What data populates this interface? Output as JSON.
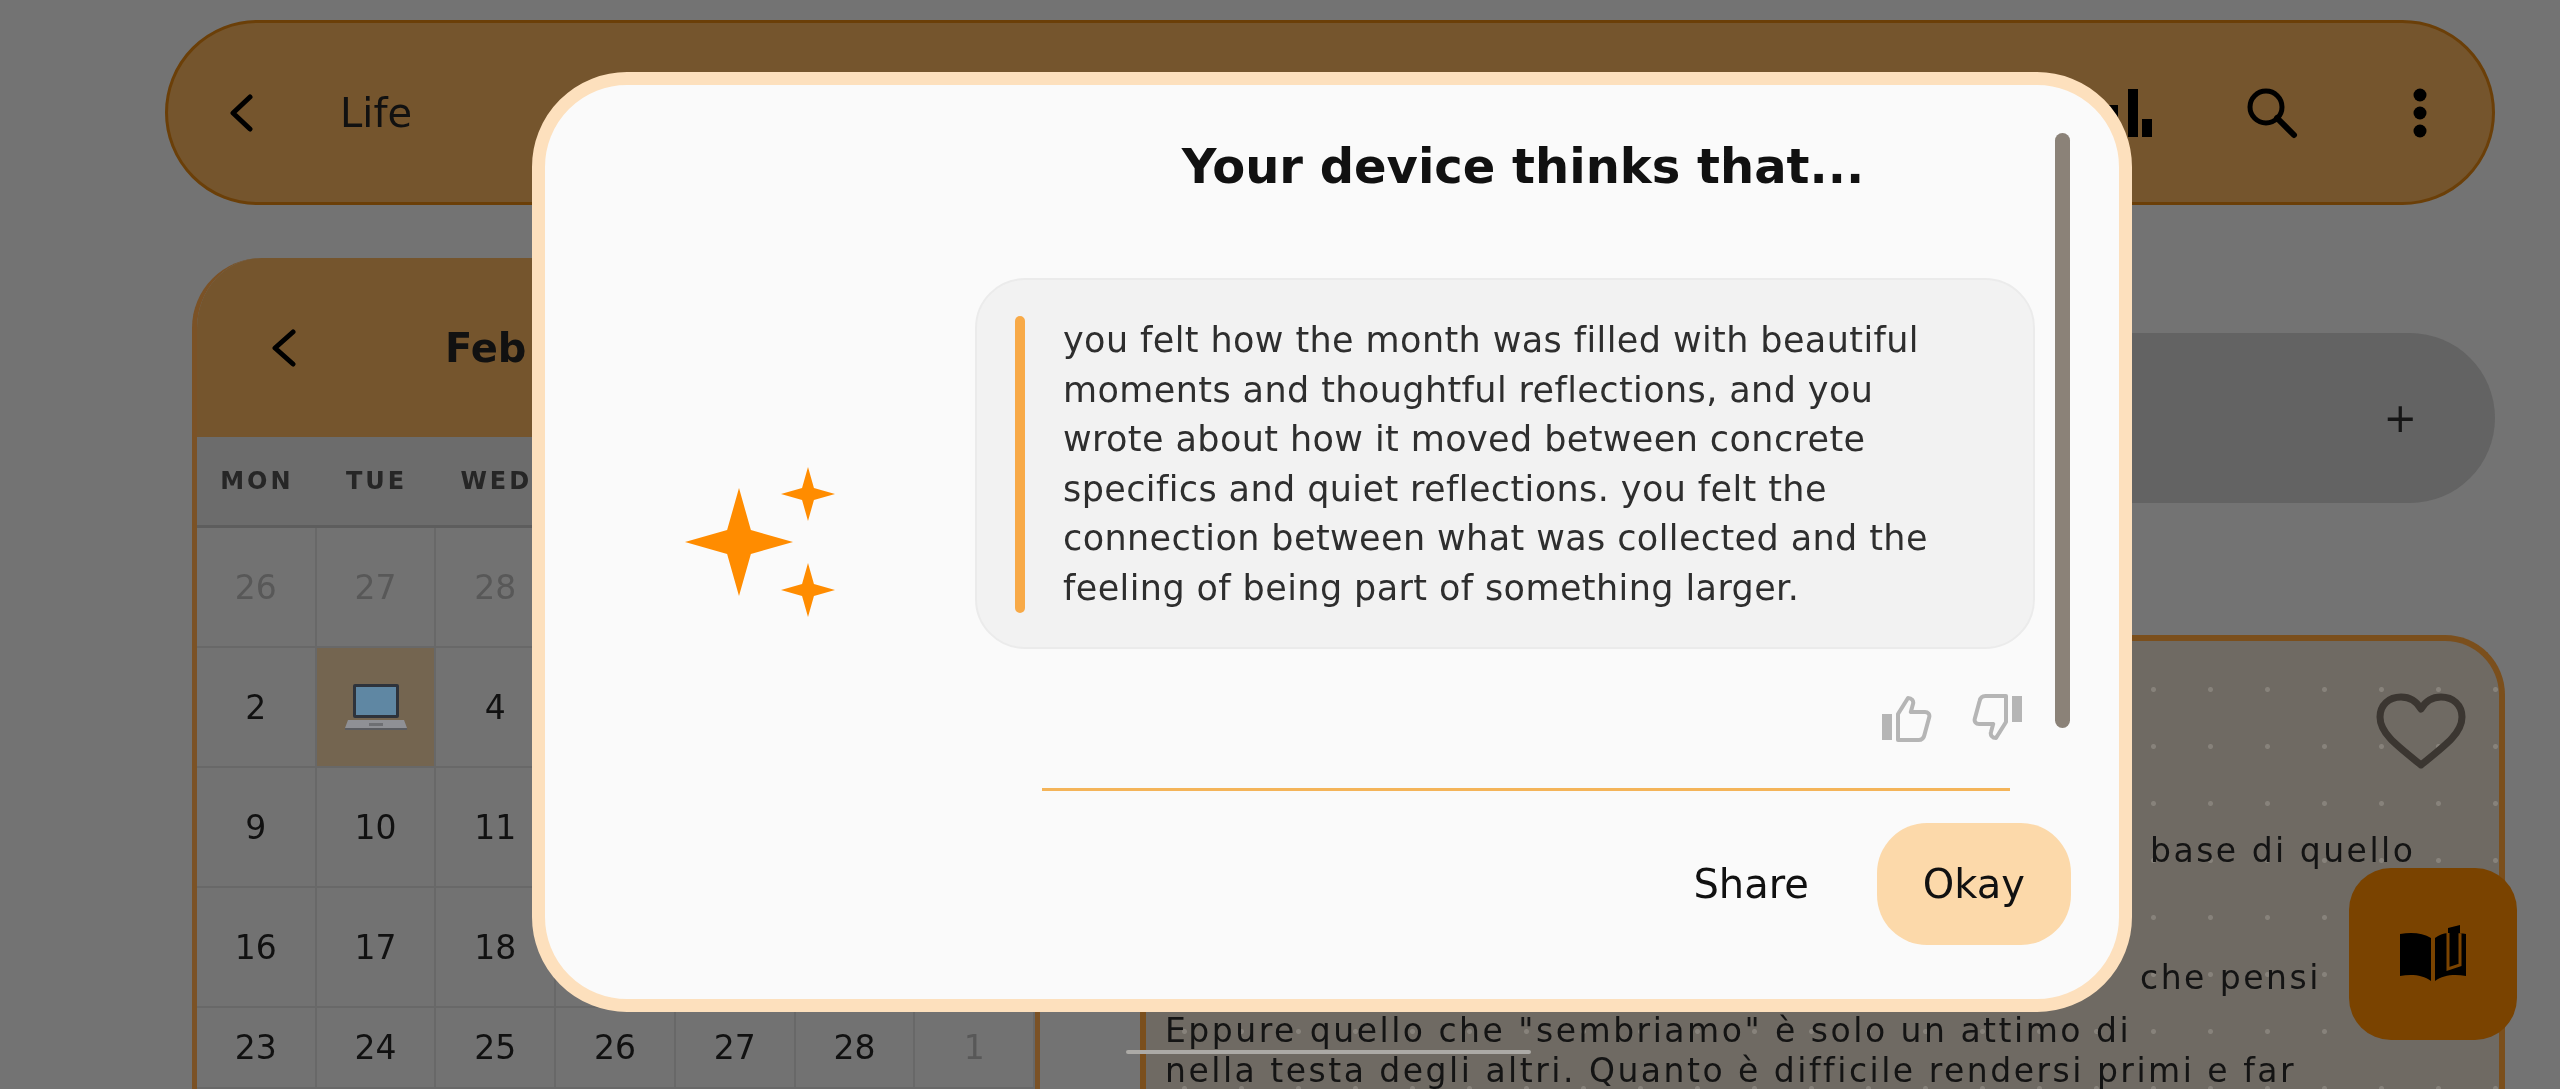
{
  "top_bar": {
    "title": "Life"
  },
  "calendar": {
    "month": "Feb",
    "weekdays": [
      "MON",
      "TUE",
      "WED"
    ],
    "weeks": [
      [
        {
          "kind": "date",
          "label": "26",
          "in_month": false,
          "has_entry": false
        },
        {
          "kind": "date",
          "label": "27",
          "in_month": false,
          "has_entry": false
        },
        {
          "kind": "date",
          "label": "28",
          "in_month": false,
          "has_entry": false
        }
      ],
      [
        {
          "kind": "date",
          "label": "2",
          "in_month": true,
          "has_entry": false
        },
        {
          "kind": "sticker",
          "in_month": true,
          "has_entry": true
        },
        {
          "kind": "date",
          "label": "4",
          "in_month": true,
          "has_entry": false
        }
      ],
      [
        {
          "kind": "date",
          "label": "9",
          "in_month": true,
          "has_entry": false
        },
        {
          "kind": "date",
          "label": "10",
          "in_month": true,
          "has_entry": false
        },
        {
          "kind": "date",
          "label": "11",
          "in_month": true,
          "has_entry": false
        }
      ],
      [
        {
          "kind": "date",
          "label": "16",
          "in_month": true,
          "has_entry": false
        },
        {
          "kind": "date",
          "label": "17",
          "in_month": true,
          "has_entry": false
        },
        {
          "kind": "date",
          "label": "18",
          "in_month": true,
          "has_entry": false
        }
      ],
      [
        {
          "kind": "date",
          "label": "23",
          "in_month": true,
          "has_entry": false
        },
        {
          "kind": "date",
          "label": "24",
          "in_month": true,
          "has_entry": false
        },
        {
          "kind": "date",
          "label": "25",
          "in_month": true,
          "has_entry": false
        },
        {
          "kind": "date",
          "label": "26",
          "in_month": true,
          "has_entry": false
        },
        {
          "kind": "date",
          "label": "27",
          "in_month": true,
          "has_entry": false
        },
        {
          "kind": "date",
          "label": "28",
          "in_month": true,
          "has_entry": false
        },
        {
          "kind": "date",
          "label": "1",
          "in_month": false,
          "has_entry": false
        }
      ]
    ]
  },
  "new_entry_bar": {
    "label": "+"
  },
  "entry_card": {
    "favorite": false,
    "lines": [
      "base di quello",
      "che pensi",
      "Eppure quello che \"sembriamo\" è solo un attimo di",
      "nella testa degli altri. Quanto è difficile rendersi primi e far"
    ]
  },
  "dialog": {
    "title": "Your device thinks that...",
    "message": "you felt how the month was filled with beautiful moments and thoughtful reflections, and you wrote about how it moved between concrete specifics and quiet reflections. you felt the connection between what was collected and the feeling of being part of something larger.",
    "feedback": {
      "liked": false,
      "disliked": false
    },
    "buttons": [
      {
        "label": "Share",
        "kind": "text"
      },
      {
        "label": "Okay",
        "kind": "filled"
      }
    ]
  }
}
